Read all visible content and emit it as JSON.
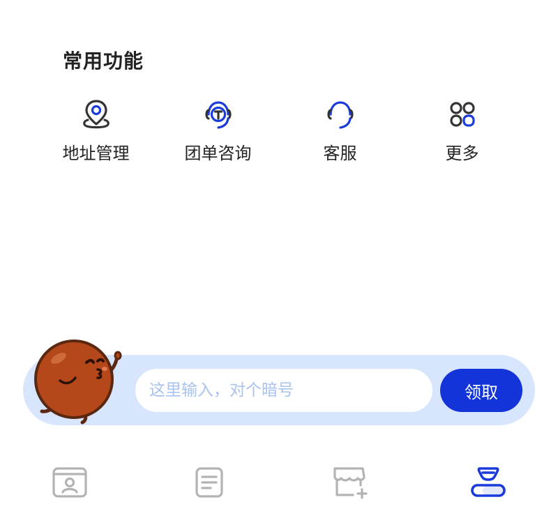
{
  "section": {
    "title": "常用功能"
  },
  "functions": [
    {
      "label": "地址管理",
      "icon": "location-pin-icon"
    },
    {
      "label": "团单咨询",
      "icon": "headset-t-icon"
    },
    {
      "label": "客服",
      "icon": "headset-icon"
    },
    {
      "label": "更多",
      "icon": "grid-more-icon"
    }
  ],
  "code_bar": {
    "placeholder": "这里输入，对个暗号",
    "button_label": "领取",
    "mascot": "cookie-mascot-icon"
  },
  "tabbar": [
    {
      "icon": "contact-card-icon",
      "active": false
    },
    {
      "icon": "document-list-icon",
      "active": false
    },
    {
      "icon": "store-add-icon",
      "active": false
    },
    {
      "icon": "profile-icon",
      "active": true
    }
  ],
  "colors": {
    "accent": "#1234d8",
    "accent_light": "#d8e6fd",
    "icon_dark": "#333333",
    "icon_blue": "#1a3bdc",
    "tab_inactive": "#b3b3b3",
    "placeholder": "#a8c2f2"
  }
}
